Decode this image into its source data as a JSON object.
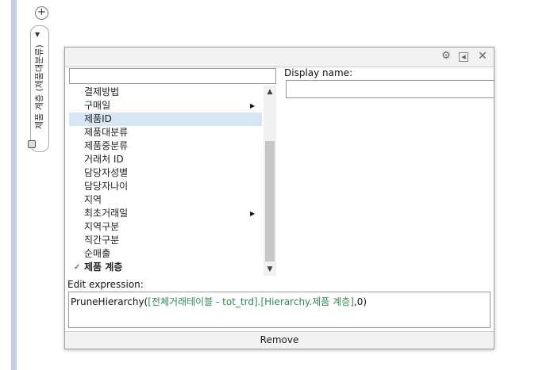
{
  "side_panel": {
    "plus_icon": "plus-icon",
    "vertical_label": "제품 계층 (제품대분류)",
    "arrow_icon": "triangle-down-icon"
  },
  "dialog": {
    "titlebar_icons": [
      "gear-icon",
      "restore-window-icon",
      "close-icon"
    ],
    "list_items": [
      {
        "label": "결제방법",
        "selected": false,
        "submenu": false,
        "checked": false
      },
      {
        "label": "구매일",
        "selected": false,
        "submenu": true,
        "checked": false
      },
      {
        "label": "제품ID",
        "selected": true,
        "submenu": false,
        "checked": false
      },
      {
        "label": "제품대분류",
        "selected": false,
        "submenu": false,
        "checked": false
      },
      {
        "label": "제품중분류",
        "selected": false,
        "submenu": false,
        "checked": false
      },
      {
        "label": "거래처 ID",
        "selected": false,
        "submenu": false,
        "checked": false
      },
      {
        "label": "담당자성별",
        "selected": false,
        "submenu": false,
        "checked": false
      },
      {
        "label": "담당자나이",
        "selected": false,
        "submenu": false,
        "checked": false
      },
      {
        "label": "지역",
        "selected": false,
        "submenu": false,
        "checked": false
      },
      {
        "label": "최초거래일",
        "selected": false,
        "submenu": true,
        "checked": false
      },
      {
        "label": "지역구분",
        "selected": false,
        "submenu": false,
        "checked": false
      },
      {
        "label": "직간구분",
        "selected": false,
        "submenu": false,
        "checked": false
      },
      {
        "label": "순매출",
        "selected": false,
        "submenu": false,
        "checked": false
      },
      {
        "label": "제품 계층",
        "selected": false,
        "submenu": false,
        "checked": true,
        "bold": true
      }
    ],
    "display_name_label": "Display name:",
    "display_name_value": "",
    "search_value": "",
    "edit_expression_label": "Edit expression:",
    "expression": {
      "fn_open": "PruneHierarchy(",
      "table_part": "[전체거래테이블 - tot_trd].[Hierarchy.제품 계층]",
      "fn_close": ",0)"
    },
    "remove_label": "Remove"
  }
}
